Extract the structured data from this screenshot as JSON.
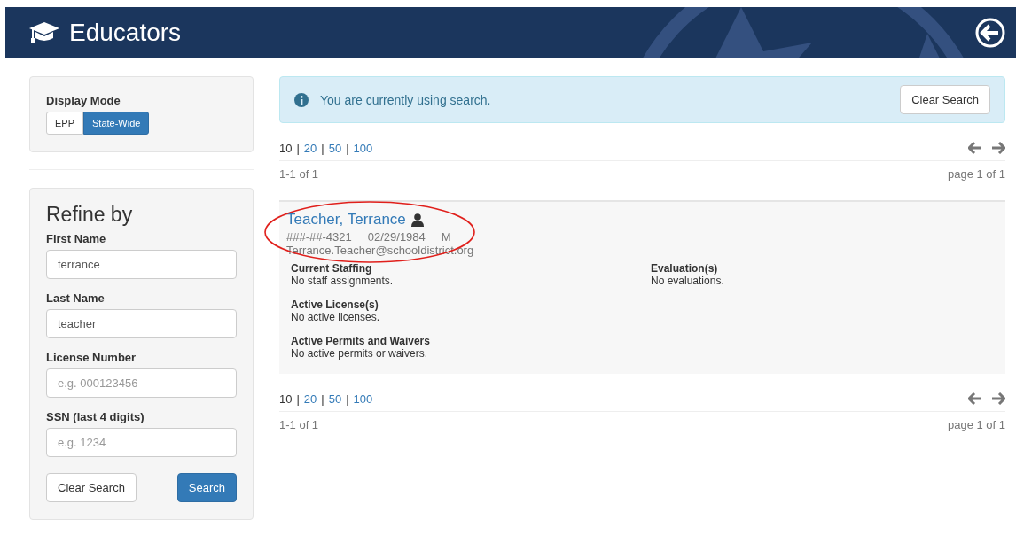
{
  "header": {
    "title": "Educators"
  },
  "display_mode": {
    "label": "Display Mode",
    "options": [
      {
        "label": "EPP",
        "selected": false
      },
      {
        "label": "State-Wide",
        "selected": true
      }
    ]
  },
  "refine": {
    "title": "Refine by",
    "fields": [
      {
        "label": "First Name",
        "value": "terrance"
      },
      {
        "label": "Last Name",
        "value": "teacher"
      },
      {
        "label": "License Number",
        "placeholder": "e.g. 000123456"
      },
      {
        "label": "SSN (last 4 digits)",
        "placeholder": "e.g. 1234"
      }
    ],
    "buttons": [
      {
        "label": "Clear Search",
        "kind": "default"
      },
      {
        "label": "Search",
        "kind": "primary"
      }
    ]
  },
  "alert": {
    "text": "You are currently using search.",
    "button": "Clear Search"
  },
  "pagers": [
    {
      "separator": "|",
      "sizes": [
        {
          "label": "10",
          "selected": true
        },
        {
          "label": "20",
          "selected": false
        },
        {
          "label": "50",
          "selected": false
        },
        {
          "label": "100",
          "selected": false
        }
      ],
      "range": "1-1 of 1",
      "page": "page 1 of 1"
    },
    {
      "separator": "|",
      "sizes": [
        {
          "label": "10",
          "selected": true
        },
        {
          "label": "20",
          "selected": false
        },
        {
          "label": "50",
          "selected": false
        },
        {
          "label": "100",
          "selected": false
        }
      ],
      "range": "1-1 of 1",
      "page": "page 1 of 1"
    }
  ],
  "results": [
    {
      "name": "Teacher, Terrance",
      "ssn": "###-##-4321",
      "dob": "02/29/1984",
      "gender": "M",
      "email": "Terrance.Teacher@schooldistrict.org",
      "highlighted": true,
      "left_sections": [
        {
          "title": "Current Staffing",
          "text": "No staff assignments."
        },
        {
          "title": "Active License(s)",
          "text": "No active licenses."
        },
        {
          "title": "Active Permits and Waivers",
          "text": "No active permits or waivers."
        }
      ],
      "right_sections": [
        {
          "title": "Evaluation(s)",
          "text": "No evaluations."
        }
      ]
    }
  ]
}
